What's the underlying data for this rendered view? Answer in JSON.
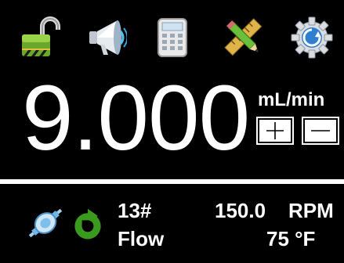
{
  "toolbar": {
    "icons": [
      "unlock-icon",
      "megaphone-icon",
      "calculator-icon",
      "tools-icon",
      "settings-gear-icon"
    ]
  },
  "display": {
    "flow_value": "9.000",
    "unit": "mL/min"
  },
  "status": {
    "tubing_size": "13#",
    "mode": "Flow",
    "speed_value": "150.0",
    "speed_unit": "RPM",
    "temperature": "75 °F"
  },
  "colors": {
    "background": "#000000",
    "text": "#ffffff",
    "accent_green": "#3a9a1e",
    "accent_blue": "#2f7fd0"
  }
}
